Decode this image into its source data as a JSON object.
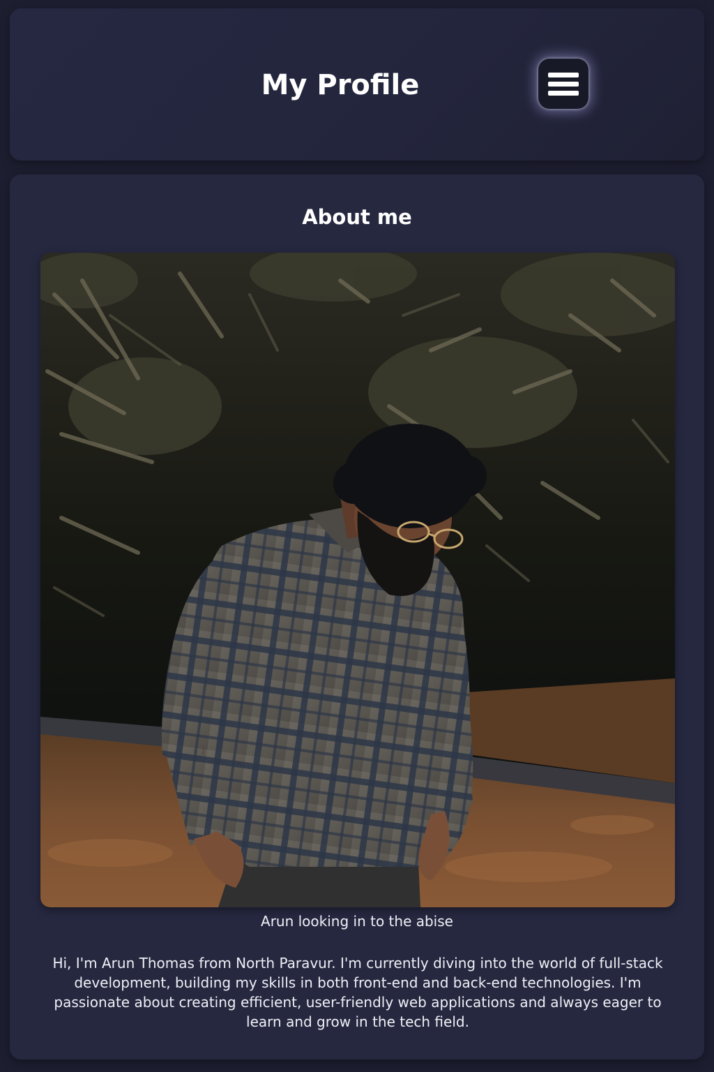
{
  "header": {
    "title": "My Profile",
    "menu_icon": "hamburger-menu-icon"
  },
  "about": {
    "heading": "About me",
    "photo_caption": "Arun looking in to the abise",
    "bio": "Hi, I'm Arun Thomas from North Paravur. I'm currently diving into the world of full-stack development, building my skills in both front-end and back-end technologies. I'm passionate about creating efficient, user-friendly web applications and always eager to learn and grow in the tech field."
  },
  "colors": {
    "page_background": "#1d1e30",
    "card_background": "#262840",
    "menu_button_background": "#181927",
    "text": "#ffffff"
  }
}
